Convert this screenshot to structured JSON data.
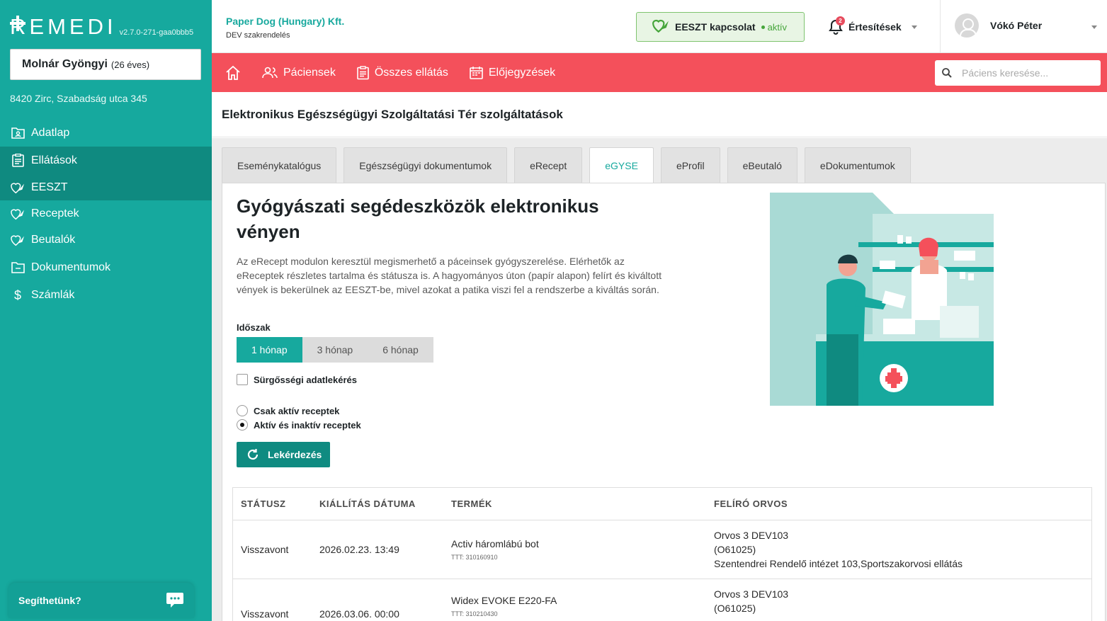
{
  "app": {
    "logo_text": "REMEDI",
    "version": "v2.7.0-271-gaa0bbb5"
  },
  "patient": {
    "name": "Molnár Gyöngyi",
    "age": "(26 éves)",
    "address": "8420 Zirc, Szabadság utca 345"
  },
  "sidebar": {
    "items": [
      {
        "label": "Adatlap",
        "icon": "folder-user-icon"
      },
      {
        "label": "Ellátások",
        "icon": "clipboard-icon"
      },
      {
        "label": "EESZT",
        "icon": "eeszt-icon"
      },
      {
        "label": "Receptek",
        "icon": "eeszt-icon"
      },
      {
        "label": "Beutalók",
        "icon": "eeszt-icon"
      },
      {
        "label": "Dokumentumok",
        "icon": "folder-icon"
      },
      {
        "label": "Számlák",
        "icon": "dollar-icon"
      }
    ],
    "help_label": "Segíthetünk?"
  },
  "header": {
    "company_name": "Paper Dog (Hungary) Kft.",
    "company_sub": "DEV szakrendelés",
    "eeszt_label": "EESZT kapcsolat",
    "eeszt_state": "aktív",
    "notifications_label": "Értesítések",
    "notifications_count": "2",
    "user_name": "Vókó Péter"
  },
  "topnav": {
    "items": [
      {
        "label": "Páciensek",
        "icon": "users-icon"
      },
      {
        "label": "Összes ellátás",
        "icon": "clipboard-icon"
      },
      {
        "label": "Előjegyzések",
        "icon": "calendar-icon"
      }
    ],
    "search_placeholder": "Páciens keresése..."
  },
  "page": {
    "title": "Elektronikus Egészségügyi Szolgáltatási Tér szolgáltatások"
  },
  "tabs": [
    {
      "label": "Eseménykatalógus",
      "active": false
    },
    {
      "label": "Egészségügyi dokumentumok",
      "active": false
    },
    {
      "label": "eRecept",
      "active": false
    },
    {
      "label": "eGYSE",
      "active": true
    },
    {
      "label": "eProfil",
      "active": false
    },
    {
      "label": "eBeutaló",
      "active": false
    },
    {
      "label": "eDokumentumok",
      "active": false
    }
  ],
  "egyse": {
    "title": "Gyógyászati segédeszközök elektronikus vényen",
    "description": "Az eRecept modulon keresztül megismerhető a páceinsek gyógyszerelése. Elérhetők az eReceptek részletes tartalma és státusza is. A hagyományos úton (papír alapon) felírt és kiváltott vények is bekerülnek az EESZT-be, mivel azokat a patika viszi fel a rendszerbe a kiváltás során.",
    "period_label": "Időszak",
    "periods": [
      "1 hónap",
      "3 hónap",
      "6 hónap"
    ],
    "period_selected": "1 hónap",
    "urgent_label": "Sürgősségi adatlekérés",
    "radio_active_only": "Csak aktív receptek",
    "radio_all": "Aktív és inaktív receptek",
    "radio_selected": "Aktív és inaktív receptek",
    "query_button": "Lekérdezés"
  },
  "table": {
    "headers": [
      "STÁTUSZ",
      "KIÁLLÍTÁS DÁTUMA",
      "TERMÉK",
      "FELÍRÓ ORVOS"
    ],
    "rows": [
      {
        "status": "Visszavont",
        "date": "2026.02.23. 13:49",
        "product": "Activ háromlábú bot",
        "code": "TTT: 310160910",
        "doctor": "Orvos 3 DEV103",
        "doctor_id": "(O61025)",
        "institution": "Szentendrei Rendelő intézet 103,Sportszakorvosi ellátás"
      },
      {
        "status": "Visszavont",
        "date": "2026.03.06. 00:00",
        "product": "Widex EVOKE E220-FA",
        "code": "TTT: 310210430",
        "doctor": "Orvos 3 DEV103",
        "doctor_id": "(O61025)",
        "institution": ""
      }
    ]
  },
  "colors": {
    "teal": "#16a99e",
    "teal_dark": "#0f8a80",
    "coral": "#f4505b",
    "eeszt_green": "#45a53a"
  }
}
